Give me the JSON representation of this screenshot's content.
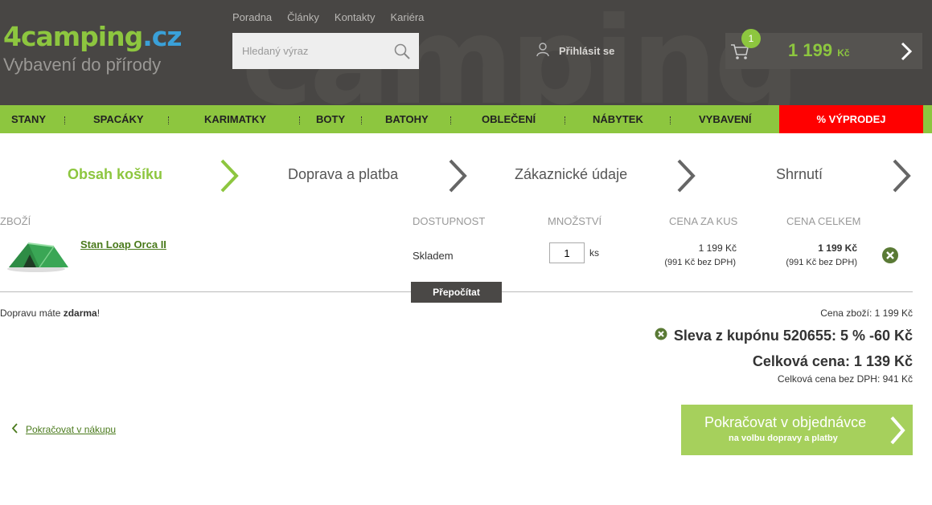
{
  "header": {
    "logo_prefix": "4",
    "logo_main": "camping",
    "logo_suffix": ".cz",
    "logo_tagline": "Vybavení do přírody",
    "top_links": [
      "Poradna",
      "Články",
      "Kontakty",
      "Kariéra"
    ],
    "search_placeholder": "Hledaný výraz",
    "login_label": "Přihlásit se",
    "cart_count": "1",
    "cart_price": "1 199",
    "cart_currency": "Kč"
  },
  "nav": {
    "items": [
      "STANY",
      "SPACÁKY",
      "KARIMATKY",
      "BOTY",
      "BATOHY",
      "OBLEČENÍ",
      "NÁBYTEK",
      "VYBAVENÍ"
    ],
    "sale_label": "% VÝPRODEJ"
  },
  "steps": [
    "Obsah košíku",
    "Doprava a platba",
    "Zákaznické údaje",
    "Shrnutí"
  ],
  "table": {
    "headers": [
      "ZBOŽÍ",
      "DOSTUPNOST",
      "MNOŽSTVÍ",
      "CENA ZA KUS",
      "CENA CELKEM"
    ],
    "row": {
      "name": "Stan Loap Orca II",
      "availability": "Skladem",
      "quantity": "1",
      "unit": "ks",
      "unit_price": "1 199 Kč",
      "unit_price_ex": "(991 Kč bez DPH)",
      "total_price": "1 199 Kč",
      "total_price_ex": "(991 Kč bez DPH)"
    },
    "recalc_label": "Přepočítat"
  },
  "summary": {
    "shipping_prefix": "Dopravu máte ",
    "shipping_bold": "zdarma",
    "shipping_suffix": "!",
    "goods_price": "Cena zboží: 1 199 Kč",
    "coupon": "Sleva z kupónu 520655: 5 % -60 Kč",
    "total": "Celková cena: 1 139 Kč",
    "total_ex": "Celková cena bez DPH: 941 Kč"
  },
  "actions": {
    "continue_shopping": "Pokračovat v nákupu",
    "continue_order": "Pokračovat v objednávce",
    "continue_order_sub": "na volbu dopravy a platby"
  },
  "colors": {
    "accent": "#8dc63f",
    "header_bg": "#484644",
    "sale": "#ff0000",
    "link": "#4a7a1c"
  }
}
